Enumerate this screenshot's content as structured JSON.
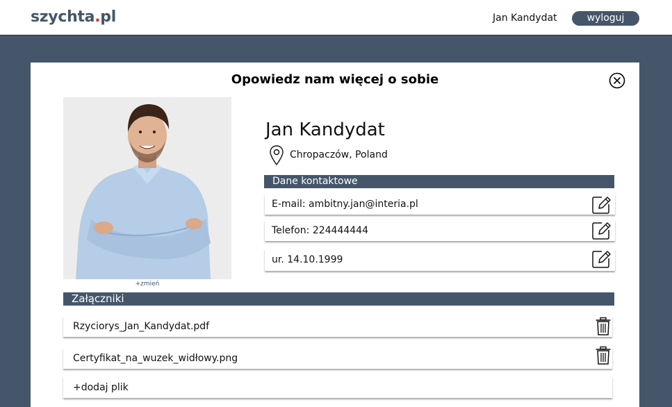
{
  "header": {
    "logo_main": "szychta",
    "logo_dot": ".",
    "logo_tld": "pl",
    "user_name": "Jan Kandydat",
    "logout_label": "wyloguj"
  },
  "modal": {
    "title": "Opowiedz nam więcej o sobie",
    "close_icon": "close-circle-icon",
    "photo": {
      "change_label": "+zmień"
    },
    "candidate": {
      "name": "Jan Kandydat",
      "location": "Chropaczów, Poland",
      "location_icon": "map-pin-icon"
    },
    "contact": {
      "header": "Dane kontaktowe",
      "rows": [
        {
          "text": "E-mail: ambitny.jan@interia.pl",
          "icon": "edit-icon"
        },
        {
          "text": "Telefon: 224444444",
          "icon": "edit-icon"
        },
        {
          "text": "ur. 14.10.1999",
          "icon": "edit-icon"
        }
      ]
    },
    "attachments": {
      "header": "Załączniki",
      "files": [
        {
          "name": "Rzyciorys_Jan_Kandydat.pdf",
          "icon": "trash-icon"
        },
        {
          "name": "Certyfikat_na_wuzek_widłowy.png",
          "icon": "trash-icon"
        }
      ],
      "add_label": "+dodaj plik"
    }
  },
  "colors": {
    "background": "#45566a",
    "accent": "#45566a",
    "logo_dot": "#c0392b",
    "surface": "#ffffff"
  }
}
